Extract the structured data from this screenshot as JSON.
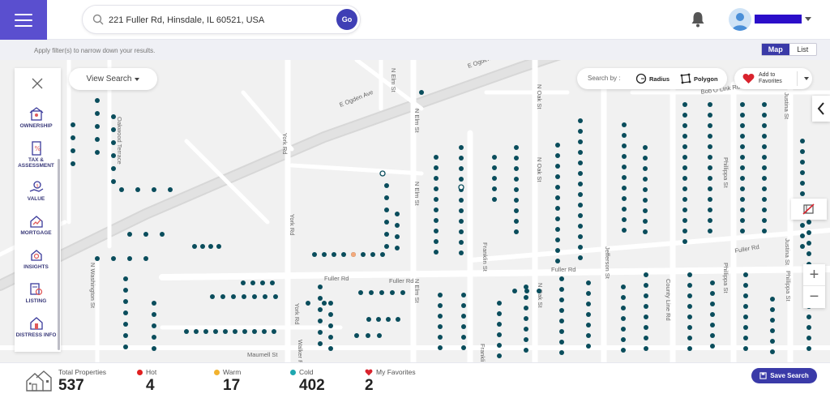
{
  "header": {
    "menu_icon": "hamburger-icon",
    "search": {
      "value": "221 Fuller Rd, Hinsdale, IL 60521, USA",
      "go_label": "Go"
    },
    "notifications_icon": "bell-icon",
    "user": {
      "avatar_icon": "user-avatar-icon",
      "name": ""
    }
  },
  "subbar": {
    "hint": "Apply filter(s) to narrow down your results.",
    "view_toggle": {
      "map": "Map",
      "list": "List",
      "active": "Map"
    }
  },
  "map_controls": {
    "view_search": "View Search",
    "search_by": {
      "label": "Search by :",
      "radius": "Radius",
      "polygon": "Polygon"
    },
    "add_to_favorites": "Add to Favorites",
    "zoom_in": "+",
    "zoom_out": "−"
  },
  "left_panel": {
    "items": [
      {
        "label": "OWNERSHIP",
        "icon": "ownership-icon"
      },
      {
        "label": "TAX & ASSESSMENT",
        "icon": "tax-icon"
      },
      {
        "label": "VALUE",
        "icon": "value-icon"
      },
      {
        "label": "MORTGAGE",
        "icon": "mortgage-icon"
      },
      {
        "label": "INSIGHTS",
        "icon": "insights-icon"
      },
      {
        "label": "LISTING",
        "icon": "listing-icon"
      },
      {
        "label": "DISTRESS INFO",
        "icon": "distress-icon"
      }
    ]
  },
  "map_labels": {
    "roads": [
      "E Ogden Ave",
      "E Ogden Ave",
      "N Elm St",
      "N Elm St",
      "York Rd",
      "York Rd",
      "York Rd",
      "Fuller Rd",
      "Fuller Rd",
      "Fuller Rd",
      "Franklin St",
      "N Oak St",
      "N Oak St",
      "Jefferson St",
      "Bob O Link Rd",
      "Justina St",
      "Phillippa St",
      "County Line Rd",
      "Maumell St",
      "Walker Rd",
      "N Washington St",
      "Oakwood Terrace",
      "N Elm St",
      "N Oak St",
      "Justina St",
      "Phillippa St",
      "Phillippa St",
      "N Elm St",
      "Fuller Rd",
      "Franklin St"
    ]
  },
  "stats": {
    "total_label": "Total Properties",
    "total_value": "537",
    "hot_label": "Hot",
    "hot_value": "4",
    "warm_label": "Warm",
    "warm_value": "17",
    "cold_label": "Cold",
    "cold_value": "402",
    "favorites_label": "My Favorites",
    "favorites_value": "2",
    "save_search": "Save Search"
  },
  "colors": {
    "brand": "#5a4fcf",
    "accent": "#3a3aa8",
    "cold_pin": "#0a4d5c",
    "hot": "#e02020",
    "warm": "#f2b22e",
    "cold": "#1ea7b0",
    "favorite": "#e02020"
  }
}
